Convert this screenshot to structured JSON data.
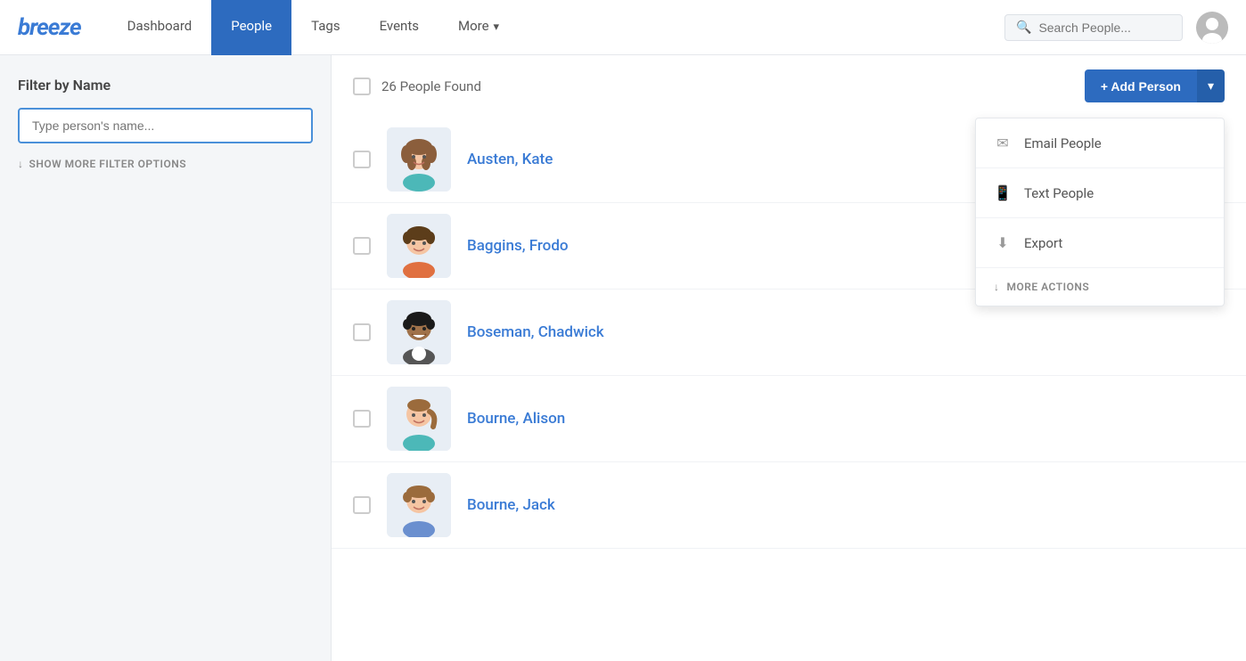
{
  "app": {
    "logo": "breeze",
    "title": "Breeze"
  },
  "header": {
    "nav": [
      {
        "id": "dashboard",
        "label": "Dashboard",
        "active": false
      },
      {
        "id": "people",
        "label": "People",
        "active": true
      },
      {
        "id": "tags",
        "label": "Tags",
        "active": false
      },
      {
        "id": "events",
        "label": "Events",
        "active": false
      },
      {
        "id": "more",
        "label": "More",
        "active": false,
        "hasChevron": true
      }
    ],
    "search_placeholder": "Search People...",
    "avatar_alt": "User avatar"
  },
  "sidebar": {
    "filter_title": "Filter by Name",
    "name_input_placeholder": "Type person's name...",
    "show_more_label": "SHOW MORE FILTER OPTIONS"
  },
  "main": {
    "people_count_label": "26 People Found",
    "add_person_label": "+ Add Person",
    "add_person_dropdown_label": "▾",
    "dropdown_menu": {
      "items": [
        {
          "id": "email-people",
          "icon": "✉",
          "label": "Email People"
        },
        {
          "id": "text-people",
          "icon": "📱",
          "label": "Text People"
        },
        {
          "id": "export",
          "icon": "⬇",
          "label": "Export"
        }
      ],
      "more_actions_label": "MORE ACTIONS"
    },
    "people": [
      {
        "id": 1,
        "name": "Austen, Kate",
        "avatar_type": "female1"
      },
      {
        "id": 2,
        "name": "Baggins, Frodo",
        "avatar_type": "male1"
      },
      {
        "id": 3,
        "name": "Boseman, Chadwick",
        "avatar_type": "male2"
      },
      {
        "id": 4,
        "name": "Bourne, Alison",
        "avatar_type": "female2"
      },
      {
        "id": 5,
        "name": "Bourne, Jack",
        "avatar_type": "male3"
      }
    ]
  },
  "colors": {
    "primary": "#2d6bbf",
    "primary_dark": "#255faa",
    "link": "#3a7bd5",
    "border": "#e5e8ec",
    "sidebar_bg": "#f4f6f8"
  }
}
